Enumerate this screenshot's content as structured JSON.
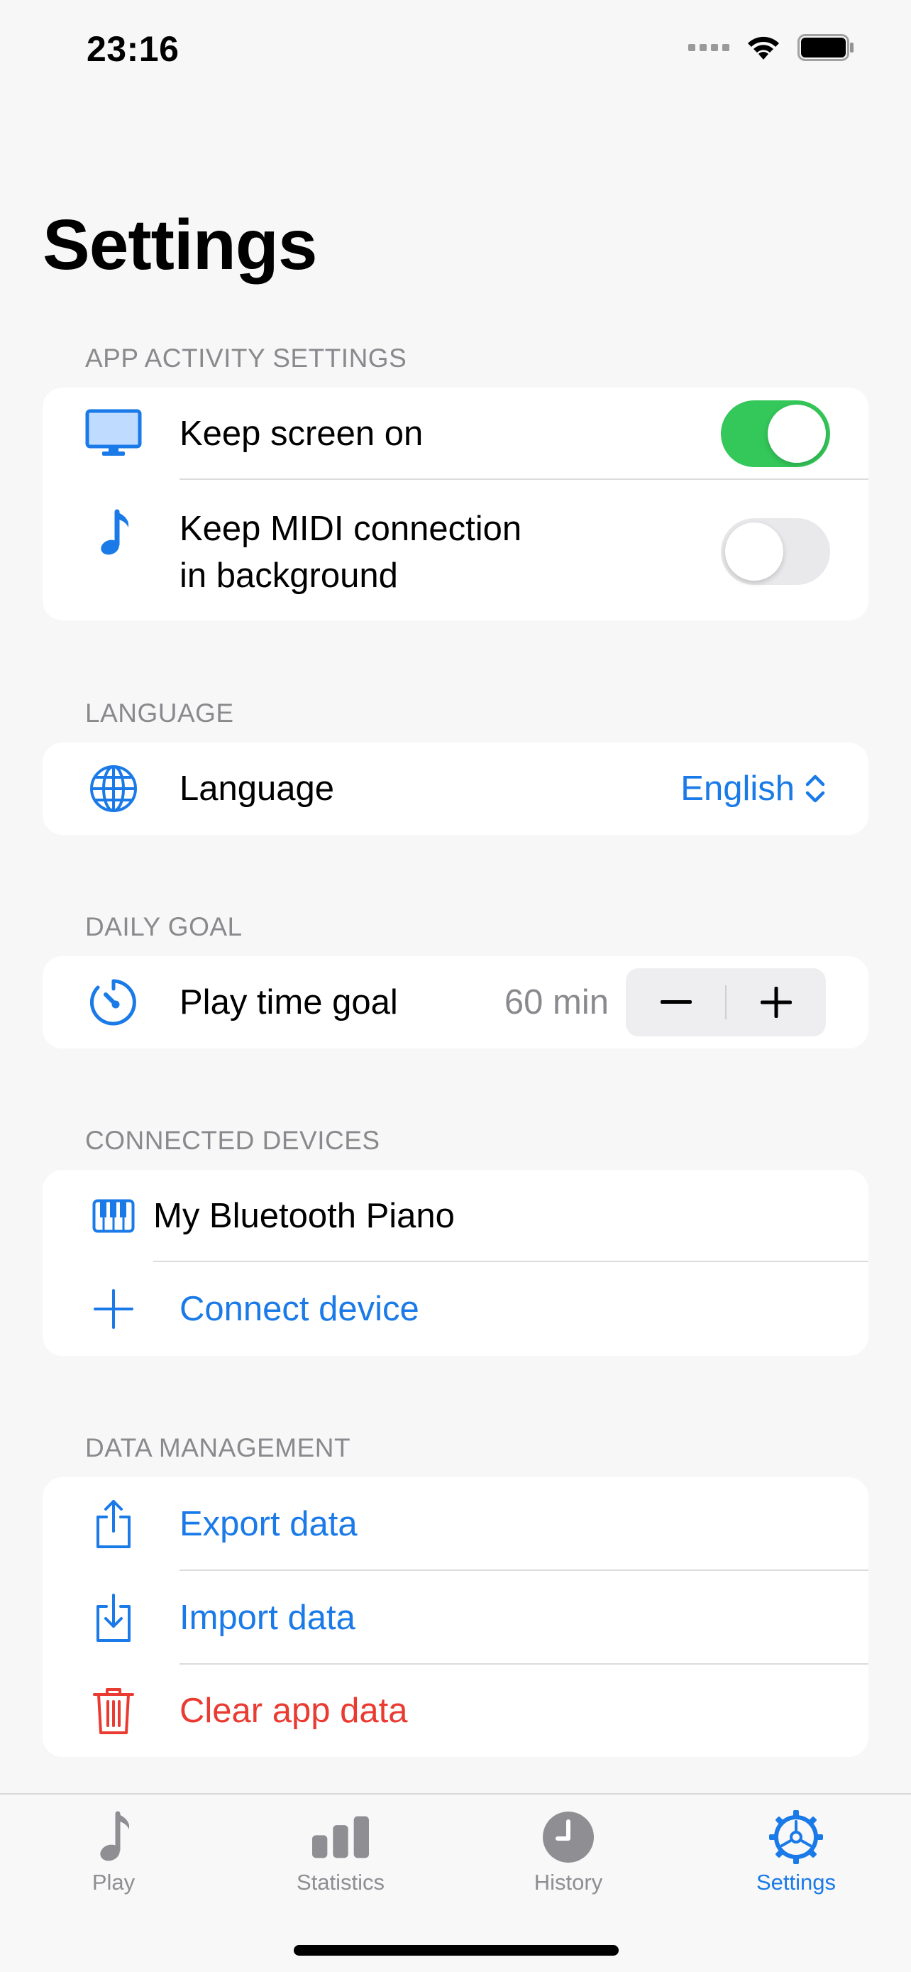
{
  "status_bar": {
    "time": "23:16"
  },
  "page": {
    "title": "Settings"
  },
  "sections": {
    "app_activity": {
      "header": "APP ACTIVITY SETTINGS",
      "keep_screen_on": {
        "label": "Keep screen on",
        "enabled": true
      },
      "keep_midi": {
        "label_line1": "Keep MIDI connection",
        "label_line2": "in background",
        "enabled": false
      }
    },
    "language": {
      "header": "LANGUAGE",
      "label": "Language",
      "value": "English"
    },
    "daily_goal": {
      "header": "DAILY GOAL",
      "label": "Play time goal",
      "value": "60 min",
      "decrement": "−",
      "increment": "+"
    },
    "connected_devices": {
      "header": "CONNECTED DEVICES",
      "device_name": "My Bluetooth Piano",
      "connect_label": "Connect device"
    },
    "data_management": {
      "header": "DATA MANAGEMENT",
      "export_label": "Export data",
      "import_label": "Import data",
      "clear_label": "Clear app data"
    }
  },
  "tabbar": {
    "tabs": [
      {
        "label": "Play",
        "icon": "music-note-icon"
      },
      {
        "label": "Statistics",
        "icon": "bar-chart-icon"
      },
      {
        "label": "History",
        "icon": "clock-icon"
      },
      {
        "label": "Settings",
        "icon": "gear-icon"
      }
    ],
    "active": "Settings"
  },
  "colors": {
    "accent": "#1A7AE8",
    "destructive": "#EA3B32",
    "toggle_on": "#34C759",
    "background": "#F7F7F7"
  }
}
